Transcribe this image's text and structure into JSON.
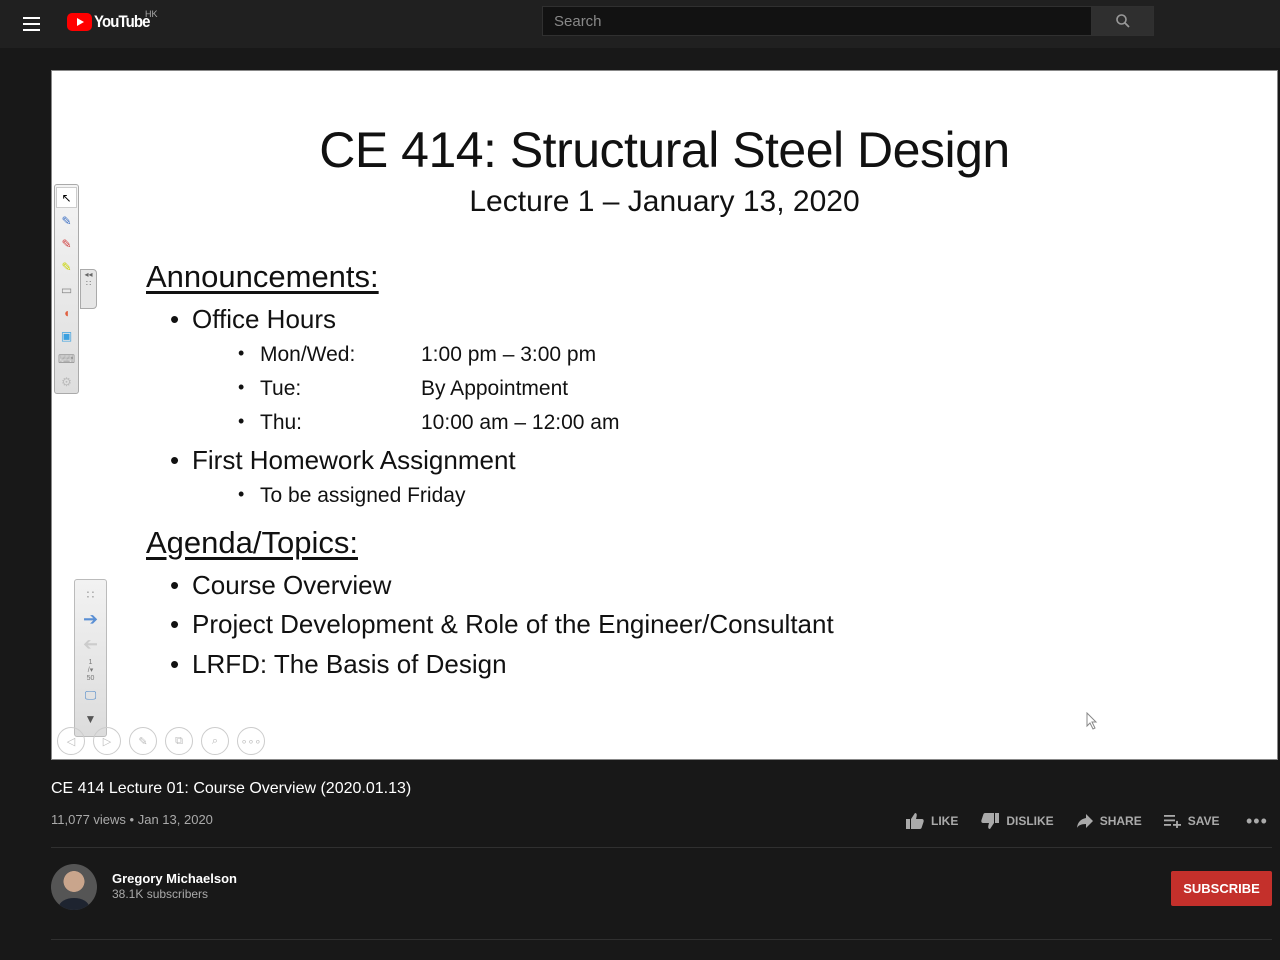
{
  "header": {
    "logo_text": "YouTube",
    "region": "HK",
    "search_placeholder": "Search",
    "search_value": ""
  },
  "slide": {
    "title": "CE 414:  Structural Steel Design",
    "subtitle": "Lecture 1 – January 13, 2020",
    "announcements_heading": "Announcements:",
    "office_hours": "Office Hours",
    "hours": [
      {
        "day": "Mon/Wed:",
        "time": "1:00 pm – 3:00 pm"
      },
      {
        "day": "Tue:",
        "time": "By Appointment"
      },
      {
        "day": "Thu:",
        "time": "10:00 am – 12:00 am"
      }
    ],
    "homework": "First Homework Assignment",
    "homework_note": "To be assigned Friday",
    "agenda_heading": "Agenda/Topics:",
    "agenda": [
      "Course Overview",
      "Project Development & Role of the Engineer/Consultant",
      "LRFD:  The Basis of Design"
    ],
    "page_current": "1",
    "page_total": "50"
  },
  "video": {
    "title": "CE 414 Lecture 01: Course Overview (2020.01.13)",
    "views": "11,077 views",
    "date": "Jan 13, 2020",
    "meta_sep": "•"
  },
  "actions": {
    "like": "LIKE",
    "dislike": "DISLIKE",
    "share": "SHARE",
    "save": "SAVE",
    "more": "•••"
  },
  "channel": {
    "name": "Gregory Michaelson",
    "subscribers": "38.1K subscribers",
    "subscribe_label": "SUBSCRIBE"
  },
  "colors": {
    "brand_red": "#ff0000",
    "subscribe_red": "#c4302b",
    "background": "#181818"
  }
}
